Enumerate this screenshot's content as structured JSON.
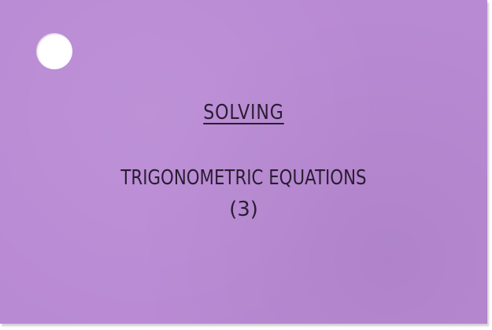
{
  "card": {
    "background_color": "#b98ad4",
    "heading": "SOLVING",
    "title": "TRIGONOMETRIC EQUATIONS",
    "subtitle": "(3)"
  }
}
